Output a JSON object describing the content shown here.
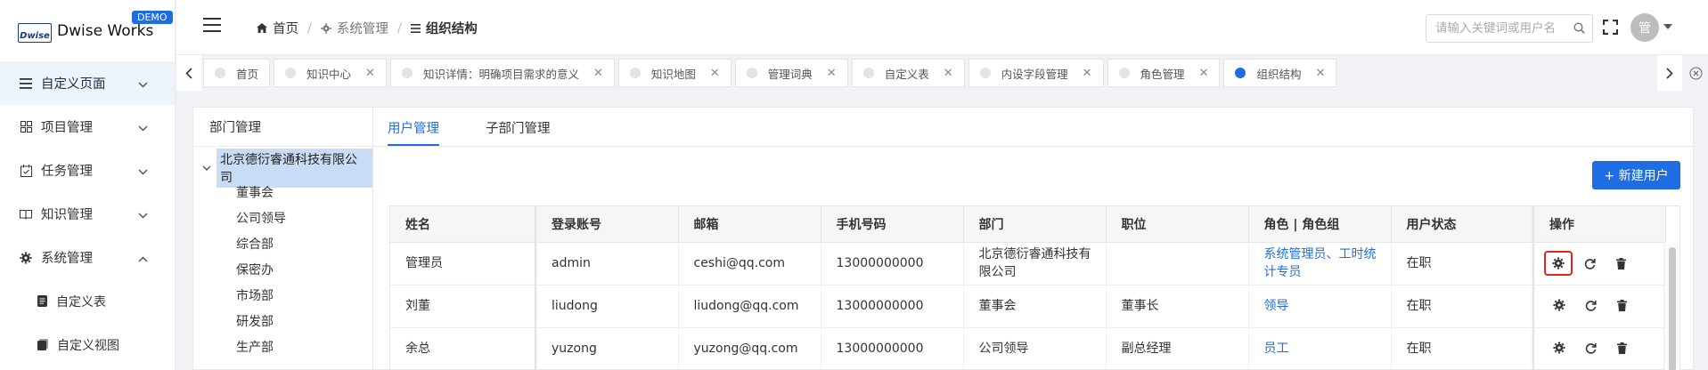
{
  "brand": {
    "logo_mark": "Dwise",
    "name": "Dwise Works",
    "badge": "DEMO"
  },
  "sidebar": {
    "items": [
      {
        "label": "自定义页面",
        "icon": "list-icon",
        "expanded": false,
        "active": true
      },
      {
        "label": "项目管理",
        "icon": "grid-icon",
        "expanded": false
      },
      {
        "label": "任务管理",
        "icon": "task-icon",
        "expanded": false
      },
      {
        "label": "知识管理",
        "icon": "book-icon",
        "expanded": false
      },
      {
        "label": "系统管理",
        "icon": "gear-icon",
        "expanded": true
      }
    ],
    "subitems": [
      {
        "label": "自定义表",
        "icon": "doc-icon"
      },
      {
        "label": "自定义视图",
        "icon": "view-icon"
      }
    ]
  },
  "header": {
    "breadcrumb": [
      {
        "label": "首页",
        "icon": "home-icon"
      },
      {
        "label": "系统管理",
        "icon": "gear-icon"
      },
      {
        "label": "组织结构",
        "icon": "list-icon"
      }
    ],
    "search_placeholder": "请输入关键词或用户名",
    "avatar_text": "管"
  },
  "tabs": [
    {
      "label": "首页",
      "closable": false
    },
    {
      "label": "知识中心",
      "closable": true
    },
    {
      "label": "知识详情：明确项目需求的意义",
      "closable": true
    },
    {
      "label": "知识地图",
      "closable": true
    },
    {
      "label": "管理词典",
      "closable": true
    },
    {
      "label": "自定义表",
      "closable": true
    },
    {
      "label": "内设字段管理",
      "closable": true
    },
    {
      "label": "角色管理",
      "closable": true
    },
    {
      "label": "组织结构",
      "closable": true,
      "active": true
    }
  ],
  "dept": {
    "title": "部门管理",
    "root": "北京德衍睿通科技有限公司",
    "children": [
      "董事会",
      "公司领导",
      "综合部",
      "保密办",
      "市场部",
      "研发部",
      "生产部"
    ]
  },
  "user_panel": {
    "subtabs": [
      "用户管理",
      "子部门管理"
    ],
    "new_user_label": "+ 新建用户",
    "columns": [
      "姓名",
      "登录账号",
      "邮箱",
      "手机号码",
      "部门",
      "职位",
      "角色 | 角色组",
      "用户状态",
      "操作"
    ],
    "rows": [
      {
        "name": "管理员",
        "account": "admin",
        "email": "ceshi@qq.com",
        "phone": "13000000000",
        "dept": "北京德衍睿通科技有限公司",
        "position": "",
        "role": "系统管理员、工时统计专员",
        "status": "在职"
      },
      {
        "name": "刘董",
        "account": "liudong",
        "email": "liudong@qq.com",
        "phone": "13000000000",
        "dept": "董事会",
        "position": "董事长",
        "role": "领导",
        "status": "在职"
      },
      {
        "name": "余总",
        "account": "yuzong",
        "email": "yuzong@qq.com",
        "phone": "13000000000",
        "dept": "公司领导",
        "position": "副总经理",
        "role": "员工",
        "status": "在职"
      }
    ]
  },
  "colors": {
    "accent": "#1e6de5",
    "highlight": "#e0261b"
  }
}
